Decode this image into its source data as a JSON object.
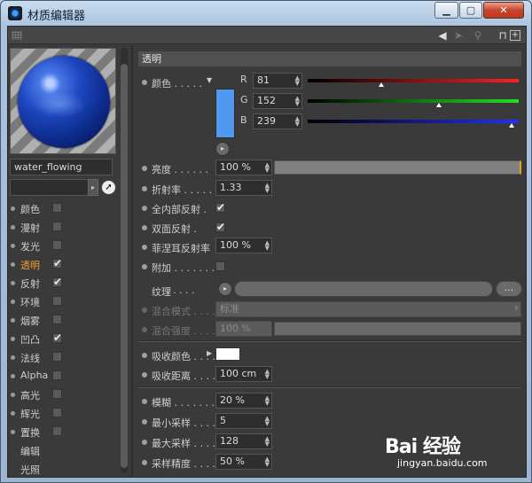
{
  "window": {
    "title": "材质编辑器",
    "min": "▁",
    "max": "▢",
    "close": "✕"
  },
  "material": {
    "name": "water_flowing"
  },
  "channels": [
    {
      "label": "颜色",
      "checked": false,
      "active": false
    },
    {
      "label": "漫射",
      "checked": false,
      "active": false
    },
    {
      "label": "发光",
      "checked": false,
      "active": false
    },
    {
      "label": "透明",
      "checked": true,
      "active": true
    },
    {
      "label": "反射",
      "checked": true,
      "active": false
    },
    {
      "label": "环境",
      "checked": false,
      "active": false
    },
    {
      "label": "烟雾",
      "checked": false,
      "active": false
    },
    {
      "label": "凹凸",
      "checked": true,
      "active": false
    },
    {
      "label": "法线",
      "checked": false,
      "active": false
    },
    {
      "label": "Alpha",
      "checked": false,
      "active": false
    },
    {
      "label": "高光",
      "checked": false,
      "active": false
    },
    {
      "label": "辉光",
      "checked": false,
      "active": false
    },
    {
      "label": "置换",
      "checked": false,
      "active": false
    },
    {
      "label": "编辑",
      "checked": null,
      "active": false
    },
    {
      "label": "光照",
      "checked": null,
      "active": false
    }
  ],
  "transparency": {
    "section_title": "透明",
    "color_label": "颜色",
    "r_label": "R",
    "r_value": "81",
    "g_label": "G",
    "g_value": "152",
    "b_label": "B",
    "b_value": "239",
    "swatch_color": "#5198ef",
    "brightness_label": "亮度",
    "brightness_value": "100 %",
    "brightness_fraction": 1.0,
    "refraction_label": "折射率",
    "refraction_value": "1.33",
    "total_internal_label": "全内部反射",
    "total_internal_checked": true,
    "double_reflection_label": "双面反射",
    "double_reflection_checked": true,
    "fresnel_label": "菲涅耳反射率",
    "fresnel_value": "100 %",
    "additive_label": "附加",
    "additive_checked": false,
    "texture_label": "纹理",
    "texture_more": "...",
    "mix_mode_label": "混合模式",
    "mix_mode_value": "标准",
    "mix_strength_label": "混合强度",
    "mix_strength_value": "100 %",
    "absorb_color_label": "吸收颜色",
    "absorb_color": "#ffffff",
    "absorb_distance_label": "吸收距离",
    "absorb_distance_value": "100 cm",
    "blur_label": "模糊",
    "blur_value": "20 %",
    "min_samples_label": "最小采样",
    "min_samples_value": "5",
    "max_samples_label": "最大采样",
    "max_samples_value": "128",
    "sample_accuracy_label": "采样精度",
    "sample_accuracy_value": "50 %"
  },
  "watermark": {
    "brand": "Bai 经验",
    "url": "jingyan.baidu.com"
  }
}
